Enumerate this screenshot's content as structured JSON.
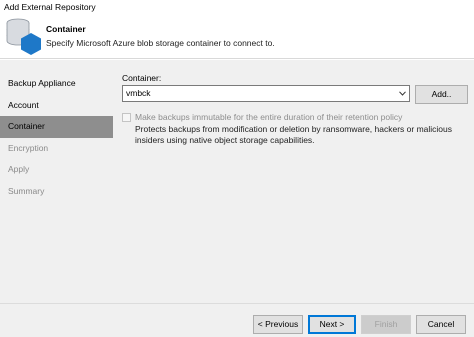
{
  "window": {
    "title": "Add External Repository"
  },
  "header": {
    "title": "Container",
    "subtitle": "Specify Microsoft Azure blob storage container to connect to.",
    "icon": "database-hexagon-icon"
  },
  "nav": {
    "items": [
      {
        "label": "Backup Appliance",
        "state": "normal"
      },
      {
        "label": "Account",
        "state": "normal"
      },
      {
        "label": "Container",
        "state": "selected"
      },
      {
        "label": "Encryption",
        "state": "disabled"
      },
      {
        "label": "Apply",
        "state": "disabled"
      },
      {
        "label": "Summary",
        "state": "disabled"
      }
    ]
  },
  "main": {
    "container_label": "Container:",
    "container_value": "vmbck",
    "add_button": "Add..",
    "immutable_checkbox": {
      "label": "Make backups immutable for the entire duration of their retention policy",
      "checked": false,
      "enabled": false
    },
    "immutable_description": "Protects backups from modification or deletion by ransomware, hackers or malicious insiders using native object storage capabilities."
  },
  "footer": {
    "previous": "< Previous",
    "next": "Next >",
    "finish": "Finish",
    "cancel": "Cancel"
  },
  "colors": {
    "selected_nav": "#8e8e8e",
    "icon_blue": "#1e78c8",
    "panel_bg": "#f0f0f0",
    "default_button_border": "#0078d7"
  }
}
